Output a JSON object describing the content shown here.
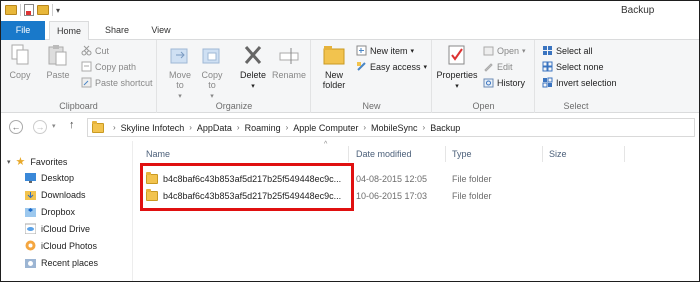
{
  "window": {
    "title": "Backup"
  },
  "tabs": {
    "file": "File",
    "home": "Home",
    "share": "Share",
    "view": "View"
  },
  "ribbon": {
    "clipboard": {
      "label": "Clipboard",
      "copy": "Copy",
      "paste": "Paste",
      "cut": "Cut",
      "copy_path": "Copy path",
      "paste_shortcut": "Paste shortcut"
    },
    "organize": {
      "label": "Organize",
      "move_to": "Move to",
      "copy_to": "Copy to",
      "delete": "Delete",
      "rename": "Rename"
    },
    "new": {
      "label": "New",
      "new_folder_1": "New",
      "new_folder_2": "folder",
      "new_item": "New item",
      "easy_access": "Easy access"
    },
    "open": {
      "label": "Open",
      "properties": "Properties",
      "open": "Open",
      "edit": "Edit",
      "history": "History"
    },
    "select": {
      "label": "Select",
      "select_all": "Select all",
      "select_none": "Select none",
      "invert_selection": "Invert selection"
    }
  },
  "address": {
    "crumbs": [
      "Skyline Infotech",
      "AppData",
      "Roaming",
      "Apple Computer",
      "MobileSync",
      "Backup"
    ]
  },
  "nav": {
    "favorites": "Favorites",
    "items": [
      "Desktop",
      "Downloads",
      "Dropbox",
      "iCloud Drive",
      "iCloud Photos",
      "Recent places"
    ]
  },
  "columns": {
    "name": "Name",
    "date": "Date modified",
    "type": "Type",
    "size": "Size"
  },
  "files": [
    {
      "name": "b4c8baf6c43b853af5d217b25f549448ec9c...",
      "date": "04-08-2015 12:05",
      "type": "File folder"
    },
    {
      "name": "b4c8baf6c43b853af5d217b25f549448ec9c...",
      "date": "10-06-2015 17:03",
      "type": "File folder"
    }
  ],
  "icons": {
    "qat_folder": "folder-icon",
    "qat_properties": "properties-icon",
    "qat_new_folder": "new-folder-icon",
    "back": "back-arrow-icon",
    "forward": "forward-arrow-icon",
    "up": "up-arrow-icon"
  },
  "colors": {
    "accent": "#1979ca",
    "highlight": "#e01010"
  }
}
